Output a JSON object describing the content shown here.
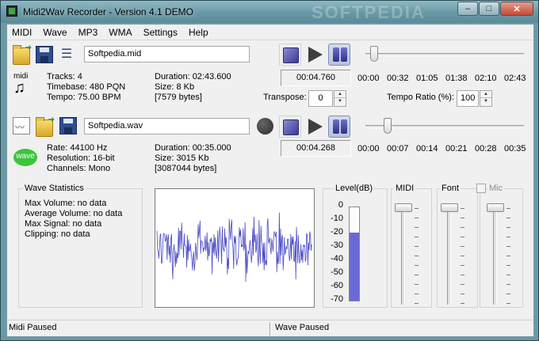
{
  "window": {
    "title": "Midi2Wav Recorder - Version 4.1 DEMO",
    "watermark": "SOFTPEDIA",
    "minimize": "–",
    "maximize": "□",
    "close": "✕"
  },
  "menu": [
    "MIDI",
    "Wave",
    "MP3",
    "WMA",
    "Settings",
    "Help"
  ],
  "midi": {
    "file_name": "Softpedia.mid",
    "badge": "midi",
    "tracks": "Tracks: 4",
    "timebase": "Timebase: 480 PQN",
    "tempo": "Tempo: 75.00 BPM",
    "duration": "Duration: 02:43.600",
    "size": "Size: 8 Kb",
    "bytes": "[7579 bytes]",
    "position": "00:04.760",
    "position_fraction": 0.03,
    "timeline": [
      "00:00",
      "00:32",
      "01:05",
      "01:38",
      "02:10",
      "02:43"
    ],
    "transpose_label": "Transpose:",
    "transpose_value": "0",
    "tempo_ratio_label": "Tempo Ratio (%):",
    "tempo_ratio_value": "100"
  },
  "wave": {
    "file_name": "Softpedia.wav",
    "badge": "wave",
    "rate": "Rate: 44100 Hz",
    "resolution": "Resolution: 16-bit",
    "channels": "Channels: Mono",
    "duration": "Duration: 00:35.000",
    "size": "Size: 3015 Kb",
    "bytes": "[3087044 bytes]",
    "position": "00:04.268",
    "position_fraction": 0.12,
    "timeline": [
      "00:00",
      "00:07",
      "00:14",
      "00:21",
      "00:28",
      "00:35"
    ]
  },
  "wave_stats": {
    "title": "Wave Statistics",
    "max_volume": "Max Volume: no data",
    "average_volume": "Average Volume: no data",
    "max_signal": "Max Signal: no data",
    "clipping": "Clipping: no data"
  },
  "level": {
    "title": "Level(dB)",
    "ticks": [
      "0",
      "-10",
      "-20",
      "-30",
      "-40",
      "-50",
      "-60",
      "-70"
    ],
    "fill_fraction": 0.73
  },
  "mixer": {
    "midi_label": "MIDI",
    "font_label": "Font",
    "mic_label": "Mic",
    "mic_checked": false,
    "midi_level": 1.0,
    "font_level": 1.0,
    "mic_level": 1.0
  },
  "status": {
    "midi": "Midi Paused",
    "wave": "Wave Paused"
  },
  "colors": {
    "accent": "#6a6ad6",
    "waveform": "#4a4ac4",
    "titlebar": "#6b9aa8"
  },
  "icons": {
    "open_midi": "folder-icon",
    "save_midi": "disk-icon",
    "midi_settings": "equalizer-icon",
    "new_wave": "document-icon",
    "open_wave": "folder-icon",
    "save_wave": "disk-icon"
  }
}
